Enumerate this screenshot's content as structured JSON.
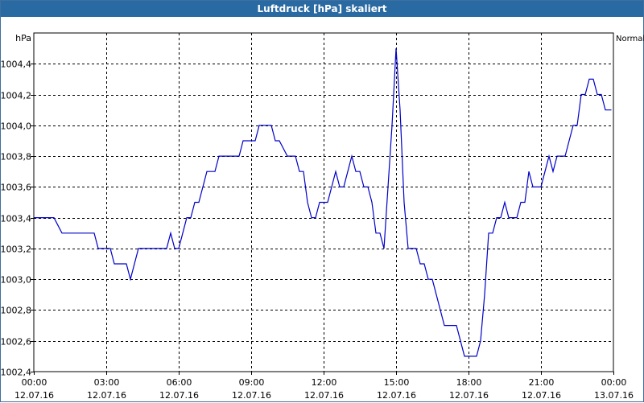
{
  "window": {
    "title": "Luftdruck [hPa] skaliert"
  },
  "chart_data": {
    "type": "line",
    "title": "Luftdruck [hPa] skaliert",
    "ylabel": "hPa",
    "legend": "Normal",
    "legend_position": "top-right",
    "grid": true,
    "line_color": "#0000c8",
    "ylim": [
      1002.4,
      1004.6
    ],
    "y_ticks": [
      "1002,4",
      "1002,6",
      "1002,8",
      "1003,0",
      "1003,2",
      "1003,4",
      "1003,6",
      "1003,8",
      "1004,0",
      "1004,2",
      "1004,4"
    ],
    "x_ticks": [
      {
        "time": "00:00",
        "date": "12.07.16"
      },
      {
        "time": "03:00",
        "date": "12.07.16"
      },
      {
        "time": "06:00",
        "date": "12.07.16"
      },
      {
        "time": "09:00",
        "date": "12.07.16"
      },
      {
        "time": "12:00",
        "date": "12.07.16"
      },
      {
        "time": "15:00",
        "date": "12.07.16"
      },
      {
        "time": "18:00",
        "date": "12.07.16"
      },
      {
        "time": "21:00",
        "date": "12.07.16"
      },
      {
        "time": "00:00",
        "date": "13.07.16"
      }
    ],
    "series": [
      {
        "x": [
          "00:00",
          "00:50",
          "01:00",
          "01:10",
          "02:30",
          "02:40",
          "03:10",
          "03:20",
          "03:50",
          "04:00",
          "04:20",
          "05:30",
          "05:40",
          "05:50",
          "06:00",
          "06:10",
          "06:20",
          "06:30",
          "06:40",
          "06:50",
          "07:00",
          "07:10",
          "07:20",
          "07:30",
          "07:40",
          "07:50",
          "08:00",
          "08:10",
          "08:20",
          "08:30",
          "08:40",
          "09:10",
          "09:20",
          "09:50",
          "10:00",
          "10:10",
          "10:30",
          "10:50",
          "11:00",
          "11:10",
          "11:20",
          "11:30",
          "11:40",
          "11:50",
          "12:00",
          "12:10",
          "12:20",
          "12:30",
          "12:40",
          "12:50",
          "13:00",
          "13:10",
          "13:20",
          "13:30",
          "13:40",
          "13:50",
          "14:00",
          "14:10",
          "14:20",
          "14:30",
          "14:40",
          "14:50",
          "15:00",
          "15:10",
          "15:20",
          "15:30",
          "15:40",
          "15:50",
          "16:00",
          "16:10",
          "16:20",
          "16:30",
          "16:40",
          "16:50",
          "17:00",
          "17:10",
          "17:20",
          "17:30",
          "17:40",
          "17:50",
          "18:00",
          "18:10",
          "18:20",
          "18:30",
          "18:40",
          "18:50",
          "19:00",
          "19:10",
          "19:20",
          "19:30",
          "19:40",
          "19:50",
          "20:00",
          "20:10",
          "20:20",
          "20:30",
          "20:40",
          "20:50",
          "21:00",
          "21:10",
          "21:20",
          "21:30",
          "21:40",
          "21:50",
          "22:00",
          "22:10",
          "22:20",
          "22:30",
          "22:40",
          "22:50",
          "23:00",
          "23:10",
          "23:20",
          "23:30",
          "23:40",
          "23:50",
          "23:55"
        ],
        "y": [
          1003.4,
          1003.4,
          1003.35,
          1003.3,
          1003.3,
          1003.2,
          1003.2,
          1003.1,
          1003.1,
          1003.0,
          1003.2,
          1003.2,
          1003.3,
          1003.2,
          1003.2,
          1003.3,
          1003.4,
          1003.4,
          1003.5,
          1003.5,
          1003.6,
          1003.7,
          1003.7,
          1003.7,
          1003.8,
          1003.8,
          1003.8,
          1003.8,
          1003.8,
          1003.8,
          1003.9,
          1003.9,
          1004.0,
          1004.0,
          1003.9,
          1003.9,
          1003.8,
          1003.8,
          1003.7,
          1003.7,
          1003.5,
          1003.4,
          1003.4,
          1003.5,
          1003.5,
          1003.5,
          1003.6,
          1003.7,
          1003.6,
          1003.6,
          1003.7,
          1003.8,
          1003.7,
          1003.7,
          1003.6,
          1003.6,
          1003.5,
          1003.3,
          1003.3,
          1003.2,
          1003.6,
          1004.0,
          1004.5,
          1004.1,
          1003.5,
          1003.2,
          1003.2,
          1003.2,
          1003.1,
          1003.1,
          1003.0,
          1003.0,
          1002.9,
          1002.8,
          1002.7,
          1002.7,
          1002.7,
          1002.7,
          1002.6,
          1002.5,
          1002.5,
          1002.5,
          1002.5,
          1002.6,
          1002.9,
          1003.3,
          1003.3,
          1003.4,
          1003.4,
          1003.5,
          1003.4,
          1003.4,
          1003.4,
          1003.5,
          1003.5,
          1003.7,
          1003.6,
          1003.6,
          1003.6,
          1003.7,
          1003.8,
          1003.7,
          1003.8,
          1003.8,
          1003.8,
          1003.9,
          1004.0,
          1004.0,
          1004.2,
          1004.2,
          1004.3,
          1004.3,
          1004.2,
          1004.2,
          1004.1,
          1004.1,
          1004.1
        ]
      }
    ]
  }
}
